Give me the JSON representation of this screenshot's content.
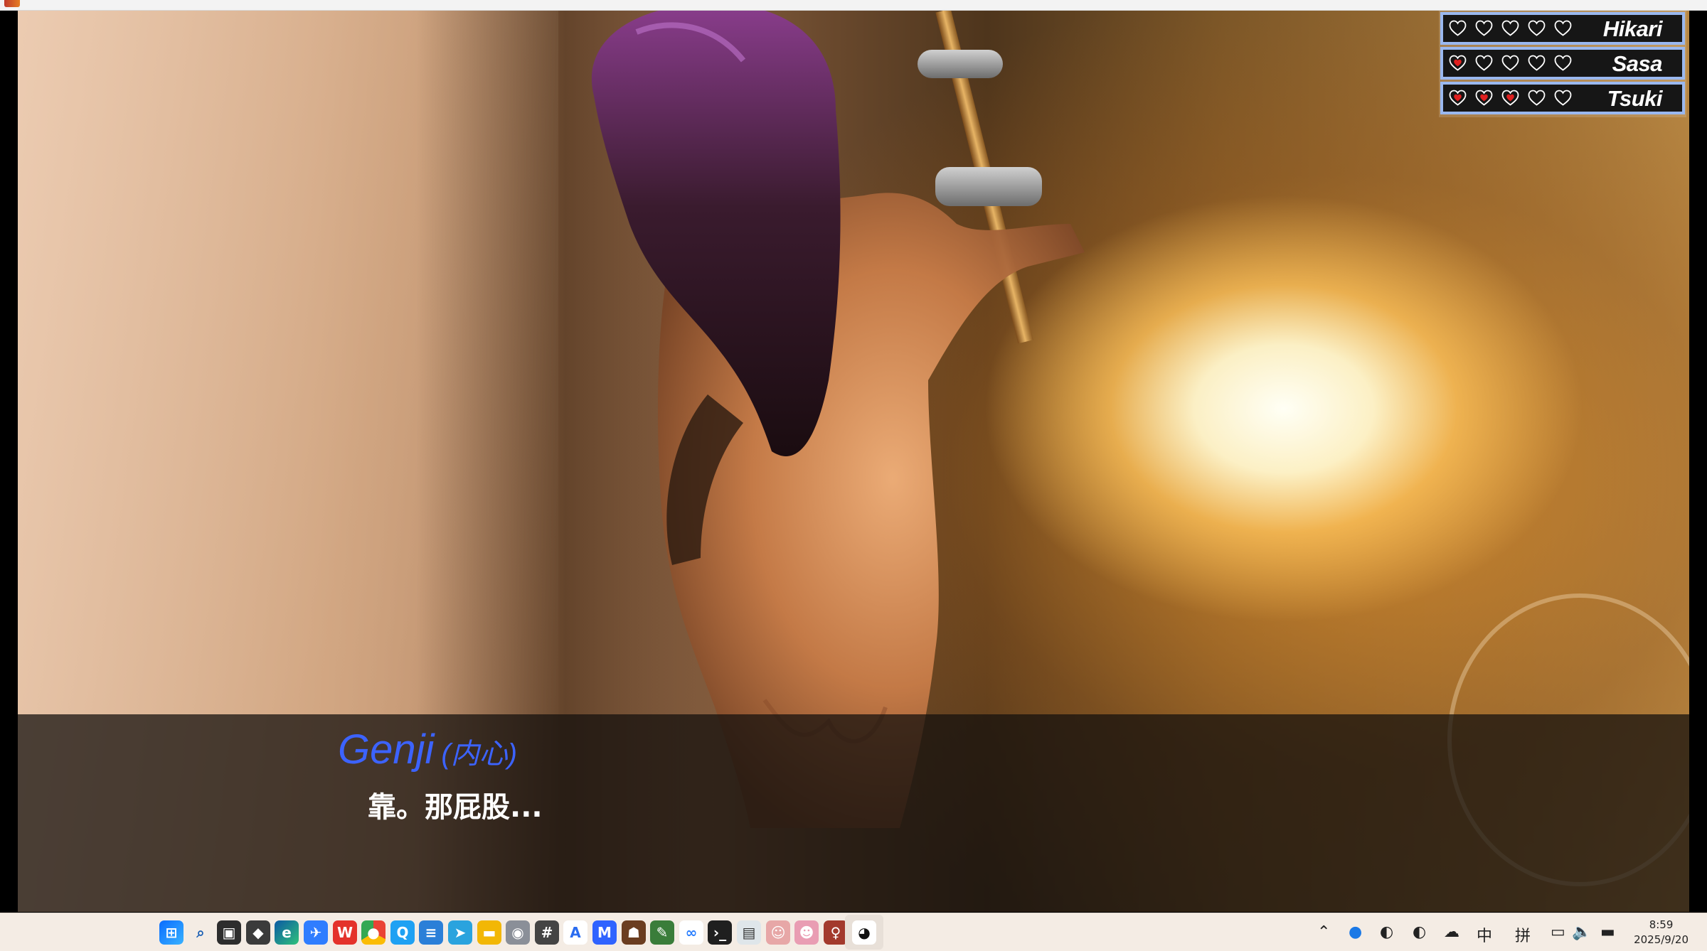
{
  "characters": [
    {
      "name": "Hikari",
      "hearts_total": 5,
      "hearts_filled": 0
    },
    {
      "name": "Sasa",
      "hearts_total": 5,
      "hearts_filled": 1
    },
    {
      "name": "Tsuki",
      "hearts_total": 5,
      "hearts_filled": 3
    }
  ],
  "colors": {
    "heart_filled": "#e0201f",
    "heart_outline": "#ffffff",
    "panel_border": "#9ab8ef",
    "speaker": "#3c63ff"
  },
  "dialogue": {
    "speaker": "Genji",
    "speaker_note": "(内心)",
    "text": "靠。那屁股..."
  },
  "taskbar": {
    "apps": [
      {
        "name": "windows-start-icon"
      },
      {
        "name": "search-icon"
      },
      {
        "name": "task-view-icon"
      },
      {
        "name": "unity-icon"
      },
      {
        "name": "edge-icon"
      },
      {
        "name": "feishu-icon"
      },
      {
        "name": "wps-icon"
      },
      {
        "name": "chrome-icon"
      },
      {
        "name": "qq-browser-icon"
      },
      {
        "name": "notepad-icon"
      },
      {
        "name": "telegram-icon"
      },
      {
        "name": "file-explorer-icon"
      },
      {
        "name": "photo-viewer-icon"
      },
      {
        "name": "grid-tool-icon"
      },
      {
        "name": "translate-icon"
      },
      {
        "name": "maxthon-icon"
      },
      {
        "name": "game-icon-1"
      },
      {
        "name": "game-icon-2"
      },
      {
        "name": "baidu-netdisk-icon"
      },
      {
        "name": "terminal-icon"
      },
      {
        "name": "window-app-icon"
      },
      {
        "name": "game-icon-3"
      },
      {
        "name": "game-icon-4"
      },
      {
        "name": "game-icon-5"
      },
      {
        "name": "qq-icon"
      }
    ],
    "tray": {
      "ime_lang": "中",
      "ime_mode": "拼",
      "time": "8:59",
      "date": "2025/9/20"
    }
  }
}
